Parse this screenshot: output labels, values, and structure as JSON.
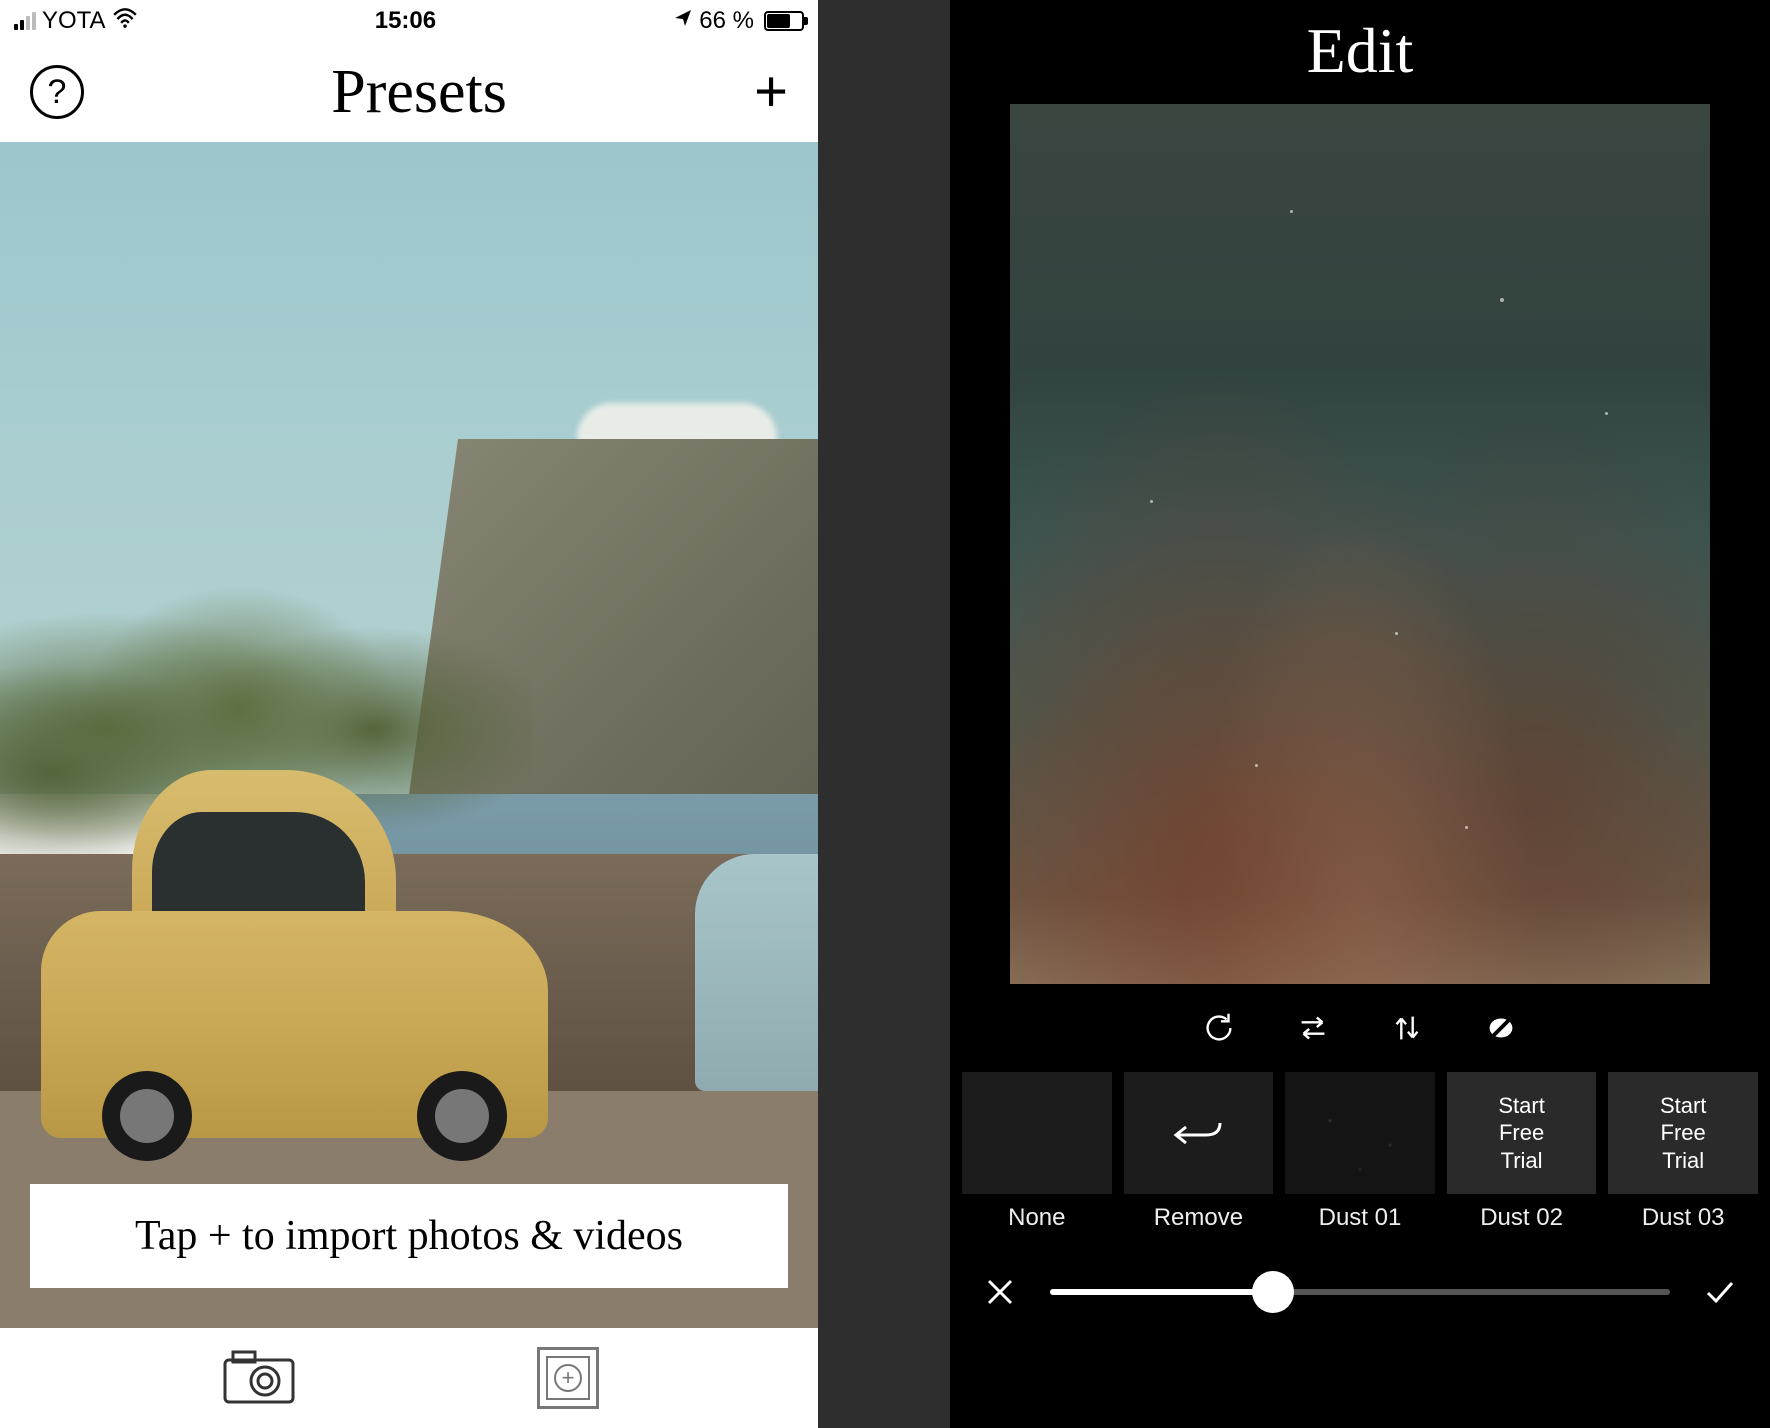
{
  "left": {
    "status": {
      "carrier": "YOTA",
      "time": "15:06",
      "battery": "66 %"
    },
    "header": {
      "help": "?",
      "title": "Presets",
      "add": "+"
    },
    "banner": "Tap + to import photos & videos"
  },
  "right": {
    "title": "Edit",
    "tools": {
      "rotate": "rotate-icon",
      "flip_h": "flip-horizontal-icon",
      "flip_v": "flip-vertical-icon",
      "circle_slash": "no-effect-icon"
    },
    "presets": [
      {
        "label": "None",
        "type": "none"
      },
      {
        "label": "Remove",
        "type": "remove"
      },
      {
        "label": "Dust 01",
        "type": "dust"
      },
      {
        "label": "Dust 02",
        "type": "locked",
        "cta1": "Start",
        "cta2": "Free",
        "cta3": "Trial"
      },
      {
        "label": "Dust 03",
        "type": "locked",
        "cta1": "Start",
        "cta2": "Free",
        "cta3": "Trial"
      }
    ],
    "slider_value": 36
  }
}
